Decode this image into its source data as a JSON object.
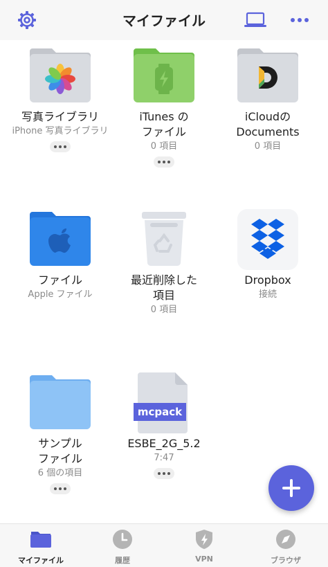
{
  "header": {
    "title": "マイファイル"
  },
  "items": [
    {
      "name_lines": [
        "写真ライブラリ",
        ""
      ],
      "sub": "iPhone 写真ライブラリ"
    },
    {
      "name_lines": [
        "iTunes の",
        "ファイル"
      ],
      "sub": "0 項目"
    },
    {
      "name_lines": [
        "iCloudの",
        "Documents"
      ],
      "sub": "0 項目"
    },
    {
      "name_lines": [
        "ファイル",
        ""
      ],
      "sub": "Apple ファイル"
    },
    {
      "name_lines": [
        "最近削除した",
        "項目"
      ],
      "sub": "0 項目"
    },
    {
      "name_lines": [
        "Dropbox",
        ""
      ],
      "sub": "接続"
    },
    {
      "name_lines": [
        "サンプル",
        "ファイル"
      ],
      "sub": "6 個の項目"
    },
    {
      "name_lines": [
        "ESBE_2G_5.2",
        ""
      ],
      "sub": "7:47",
      "file_label": "mcpack"
    }
  ],
  "tabs": [
    {
      "label": "マイファイル",
      "icon": "folder-icon"
    },
    {
      "label": "履歴",
      "icon": "clock-icon"
    },
    {
      "label": "VPN",
      "icon": "shield-icon"
    },
    {
      "label": "ブラウザ",
      "icon": "compass-icon"
    }
  ],
  "colors": {
    "accent": "#5b63dc",
    "folder_gray": "#d8dbe0",
    "folder_green": "#8fd06a",
    "folder_blue": "#2f86ea"
  }
}
